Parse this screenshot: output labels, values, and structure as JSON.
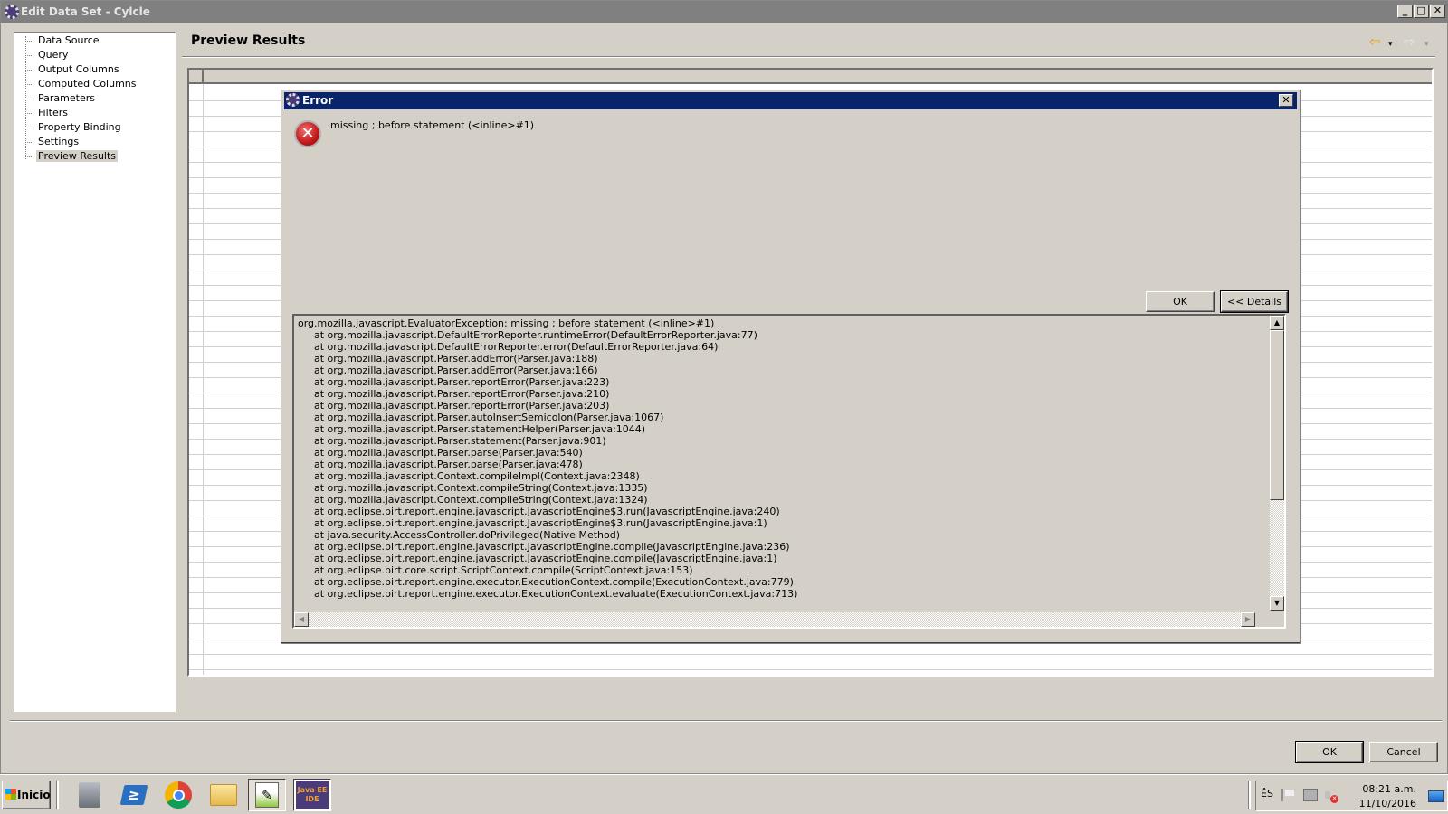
{
  "window": {
    "title": "Edit Data Set - Cylcle",
    "minimize_label": "_",
    "maximize_label": "□",
    "close_label": "✕"
  },
  "nav": {
    "items": [
      {
        "label": "Data Source",
        "selected": false
      },
      {
        "label": "Query",
        "selected": false
      },
      {
        "label": "Output Columns",
        "selected": false
      },
      {
        "label": "Computed Columns",
        "selected": false
      },
      {
        "label": "Parameters",
        "selected": false
      },
      {
        "label": "Filters",
        "selected": false
      },
      {
        "label": "Property Binding",
        "selected": false
      },
      {
        "label": "Settings",
        "selected": false
      },
      {
        "label": "Preview Results",
        "selected": true
      }
    ]
  },
  "preview": {
    "title": "Preview Results",
    "back_icon": "⇦",
    "forward_icon": "⇨",
    "dropdown_icon": "▾"
  },
  "footer": {
    "ok_label": "OK",
    "cancel_label": "Cancel"
  },
  "dialog": {
    "title": "Error",
    "close_label": "✕",
    "icon": "✕",
    "message": "missing ; before statement (<inline>#1)",
    "ok_label": "OK",
    "details_label": "<< Details",
    "stack_trace": [
      "org.mozilla.javascript.EvaluatorException: missing ; before statement (<inline>#1)",
      "at org.mozilla.javascript.DefaultErrorReporter.runtimeError(DefaultErrorReporter.java:77)",
      "at org.mozilla.javascript.DefaultErrorReporter.error(DefaultErrorReporter.java:64)",
      "at org.mozilla.javascript.Parser.addError(Parser.java:188)",
      "at org.mozilla.javascript.Parser.addError(Parser.java:166)",
      "at org.mozilla.javascript.Parser.reportError(Parser.java:223)",
      "at org.mozilla.javascript.Parser.reportError(Parser.java:210)",
      "at org.mozilla.javascript.Parser.reportError(Parser.java:203)",
      "at org.mozilla.javascript.Parser.autoInsertSemicolon(Parser.java:1067)",
      "at org.mozilla.javascript.Parser.statementHelper(Parser.java:1044)",
      "at org.mozilla.javascript.Parser.statement(Parser.java:901)",
      "at org.mozilla.javascript.Parser.parse(Parser.java:540)",
      "at org.mozilla.javascript.Parser.parse(Parser.java:478)",
      "at org.mozilla.javascript.Context.compileImpl(Context.java:2348)",
      "at org.mozilla.javascript.Context.compileString(Context.java:1335)",
      "at org.mozilla.javascript.Context.compileString(Context.java:1324)",
      "at org.eclipse.birt.report.engine.javascript.JavascriptEngine$3.run(JavascriptEngine.java:240)",
      "at org.eclipse.birt.report.engine.javascript.JavascriptEngine$3.run(JavascriptEngine.java:1)",
      "at java.security.AccessController.doPrivileged(Native Method)",
      "at org.eclipse.birt.report.engine.javascript.JavascriptEngine.compile(JavascriptEngine.java:236)",
      "at org.eclipse.birt.report.engine.javascript.JavascriptEngine.compile(JavascriptEngine.java:1)",
      "at org.eclipse.birt.core.script.ScriptContext.compile(ScriptContext.java:153)",
      "at org.eclipse.birt.report.engine.executor.ExecutionContext.compile(ExecutionContext.java:779)",
      "at org.eclipse.birt.report.engine.executor.ExecutionContext.evaluate(ExecutionContext.java:713)"
    ]
  },
  "taskbar": {
    "start_label": "Inicio",
    "apps": [
      {
        "name": "server-manager",
        "icon": "🧰",
        "active": false
      },
      {
        "name": "powershell",
        "icon": "≥",
        "active": false
      },
      {
        "name": "chrome",
        "icon": "◉",
        "active": false
      },
      {
        "name": "file-explorer",
        "icon": "📁",
        "active": false
      },
      {
        "name": "notepad-plus-plus",
        "icon": "✎",
        "active": false
      },
      {
        "name": "eclipse-java-ee-ide",
        "icon": "Java EE IDE",
        "active": true
      }
    ],
    "language": "ES",
    "tray_expand": "˄",
    "clock_time": "08:21 a.m.",
    "clock_date": "11/10/2016"
  }
}
